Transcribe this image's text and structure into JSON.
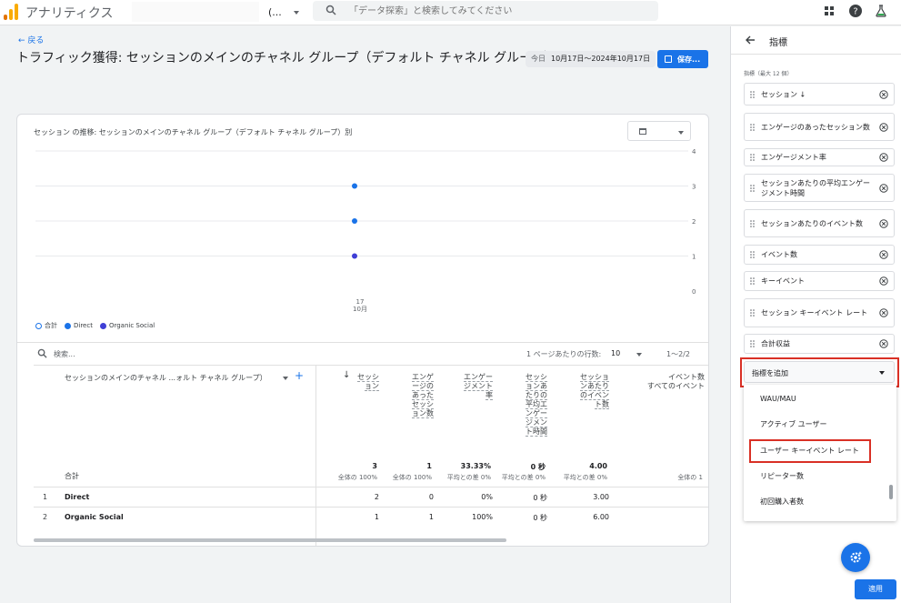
{
  "topbar": {
    "app_title": "アナリティクス",
    "account_text": "(...",
    "search_placeholder": "「データ探索」と検索してみてください"
  },
  "header": {
    "back_label": "← 戻る",
    "title": "トラフィック獲得: セッションのメインのチャネル グループ（デフォルト チャネル グループ）",
    "date_today": "今日",
    "date_range": "10月17日～2024年10月17日",
    "save_label": "保存..."
  },
  "chart_data": {
    "type": "scatter",
    "title": "セッション の推移: セッションのメインのチャネル グループ（デフォルト チャネル グループ）別",
    "x": [
      "17"
    ],
    "x_sub": "10月",
    "ylim": [
      0,
      4
    ],
    "yticks": [
      "0",
      "1",
      "2",
      "3",
      "4"
    ],
    "series": [
      {
        "name": "合計",
        "values": [
          3
        ],
        "color": "#1a73e8"
      },
      {
        "name": "Direct",
        "values": [
          2
        ],
        "color": "#1a73e8"
      },
      {
        "name": "Organic Social",
        "values": [
          1
        ],
        "color": "#3f3fd6"
      }
    ],
    "grid": true,
    "legend": "bottom-left"
  },
  "table": {
    "search_placeholder": "検索...",
    "rows_per_page_label": "1 ページあたりの行数:",
    "rows_per_page_value": "10",
    "pager": "1～2/2",
    "dimension_header": "セッションのメインのチャネル ...ォルト チャネル グループ）",
    "metric_headers": [
      [
        "セッシ",
        "ョン"
      ],
      [
        "エンゲ",
        "ージの",
        "あった",
        "セッシ",
        "ョン数"
      ],
      [
        "エンゲー",
        "ジメント",
        "率"
      ],
      [
        "セッシ",
        "ョンあ",
        "たりの",
        "平均エ",
        "ンゲー",
        "ジメン",
        "ト時間"
      ],
      [
        "セッショ",
        "ンあたり",
        "のイベン",
        "ト数"
      ],
      [
        "イベント数",
        "すべてのイベント"
      ]
    ],
    "total_label": "合計",
    "totals": [
      {
        "value": "3",
        "sub": "全体の 100%"
      },
      {
        "value": "1",
        "sub": "全体の 100%"
      },
      {
        "value": "33.33%",
        "sub": "平均との差 0%"
      },
      {
        "value": "0 秒",
        "sub": "平均との差 0%"
      },
      {
        "value": "4.00",
        "sub": "平均との差 0%"
      },
      {
        "value": "",
        "sub": "全体の 1"
      }
    ],
    "rows": [
      {
        "index": "1",
        "name": "Direct",
        "cells": [
          "2",
          "0",
          "0%",
          "0 秒",
          "3.00"
        ]
      },
      {
        "index": "2",
        "name": "Organic Social",
        "cells": [
          "1",
          "1",
          "100%",
          "0 秒",
          "6.00"
        ]
      }
    ]
  },
  "panel": {
    "title": "指標",
    "subtitle": "指標（最大 12 個）",
    "metrics": [
      "セッション  ↓",
      "エンゲージのあったセッション数",
      "エンゲージメント率",
      "セッションあたりの平均エンゲージメント時間",
      "セッションあたりのイベント数",
      "イベント数",
      "キーイベント",
      "セッション キーイベント レート",
      "合計収益"
    ],
    "add_metric_label": "指標を追加",
    "dropdown_items": [
      "WAU/MAU",
      "アクティブ ユーザー",
      "ユーザー キーイベント レート",
      "リピーター数",
      "初回購入者数"
    ],
    "apply_label": "適用"
  },
  "colors": {
    "accent": "#1a73e8",
    "highlight": "#d93025",
    "logo": "#f9ab00"
  }
}
